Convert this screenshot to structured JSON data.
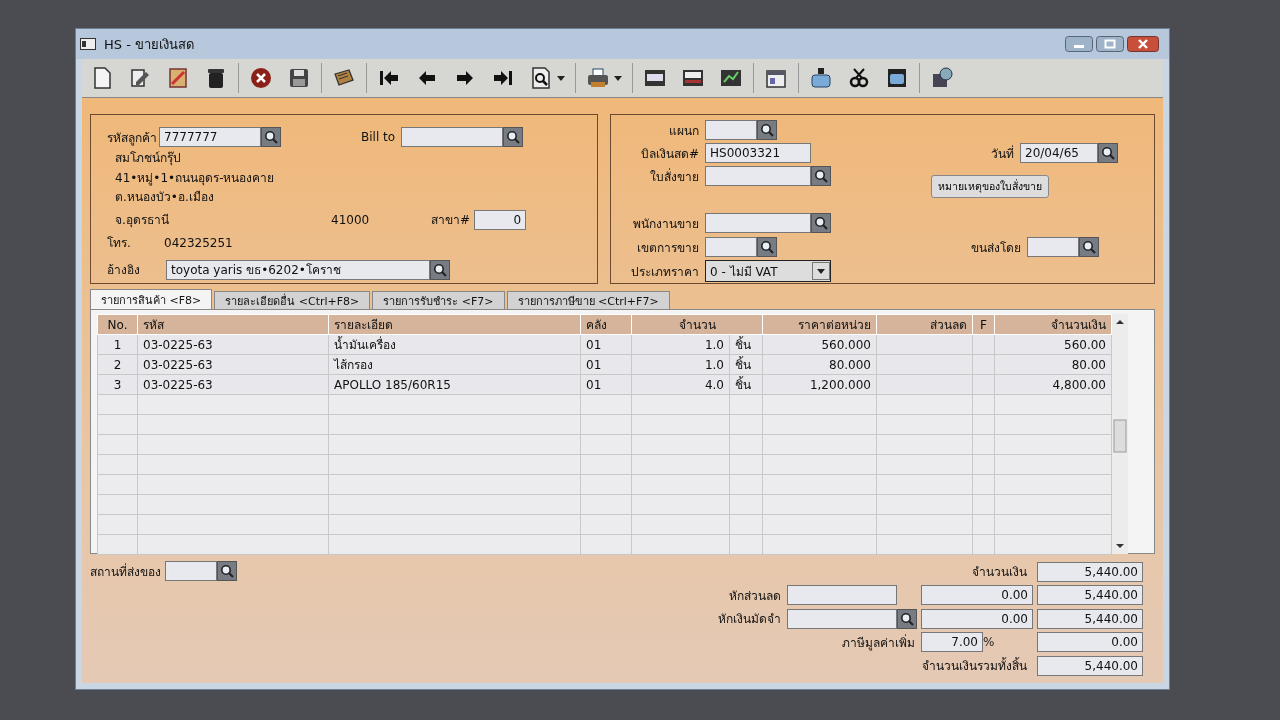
{
  "window": {
    "title": "HS - ขายเงินสด"
  },
  "customer": {
    "code_label": "รหัสลูกค้า",
    "code": "7777777",
    "bill_to_label": "Bill to",
    "name": "สมโภชน์กรุ๊ป",
    "address_lines": [
      "41•หมู่•1•ถนนอุดร-หนองคาย",
      "ต.หนองบัว•อ.เมือง"
    ],
    "province": "จ.อุดรธานี",
    "postcode": "41000",
    "branch_label": "สาขา#",
    "branch": "0",
    "phone_label": "โทร.",
    "phone": "042325251",
    "reference_label": "อ้างอิง",
    "reference": "toyota yaris ขธ•6202•โคราช"
  },
  "document": {
    "fields": [
      {
        "kind": "field",
        "label": "แผนก",
        "lookup": true
      },
      {
        "kind": "field",
        "label": "บิลเงินสด#",
        "value": "HS0003321",
        "lookup": false
      },
      {
        "kind": "field",
        "label": "วันที่",
        "value": "20/04/65",
        "lookup": true
      },
      {
        "kind": "field",
        "label": "ใบสั่งขาย",
        "lookup": true
      },
      {
        "kind": "button",
        "label": "หมายเหตุของใบสั่งขาย"
      },
      {
        "kind": "field",
        "label": "พนักงานขาย",
        "lookup": true
      },
      {
        "kind": "field",
        "label": "เขตการขาย",
        "lookup": true
      },
      {
        "kind": "field",
        "label": "ขนส่งโดย",
        "lookup": true
      },
      {
        "kind": "dropdown",
        "label": "ประเภทราคา",
        "value": "0 - ไม่มี VAT"
      }
    ]
  },
  "tabs": [
    {
      "label": "รายการสินค้า <F8>",
      "selected": true
    },
    {
      "label": "รายละเอียดอื่น <Ctrl+F8>",
      "selected": false
    },
    {
      "label": "รายการรับชำระ <F7>",
      "selected": false
    },
    {
      "label": "รายการภาษีขาย <Ctrl+F7>",
      "selected": false
    }
  ],
  "table": {
    "columns": [
      "No.",
      "รหัส",
      "รายละเอียด",
      "คลัง",
      "จำนวน",
      "ราคาต่อหน่วย",
      "ส่วนลด",
      "F",
      "จำนวนเงิน"
    ],
    "rows": [
      {
        "no": "1",
        "code": "03-0225-63",
        "description": "น้ำมันเครื่อง",
        "warehouse": "01",
        "quantity": "1.0",
        "unit": "ชิ้น",
        "unit_price": "560.000",
        "amount": "560.00"
      },
      {
        "no": "2",
        "code": "03-0225-63",
        "description": "ไส้กรอง",
        "warehouse": "01",
        "quantity": "1.0",
        "unit": "ชิ้น",
        "unit_price": "80.000",
        "amount": "80.00"
      },
      {
        "no": "3",
        "code": "03-0225-63",
        "description": "APOLLO 185/60R15",
        "warehouse": "01",
        "quantity": "4.0",
        "unit": "ชิ้น",
        "unit_price": "1,200.000",
        "amount": "4,800.00"
      }
    ]
  },
  "delivery": {
    "label": "สถานที่ส่งของ"
  },
  "totals": {
    "subtotal_label": "จำนวนเงิน",
    "subtotal": "5,440.00",
    "discount_label": "หักส่วนลด",
    "discount": "0.00",
    "after_discount": "5,440.00",
    "deposit_label": "หักเงินมัดจำ",
    "deposit": "0.00",
    "after_deposit": "5,440.00",
    "vat_label": "ภาษีมูลค่าเพิ่ม",
    "vat_rate": "7.00",
    "vat_percent": "%",
    "vat": "0.00",
    "grand_total_label": "จำนวนเงินรวมทั้งสิ้น",
    "grand_total": "5,440.00"
  }
}
